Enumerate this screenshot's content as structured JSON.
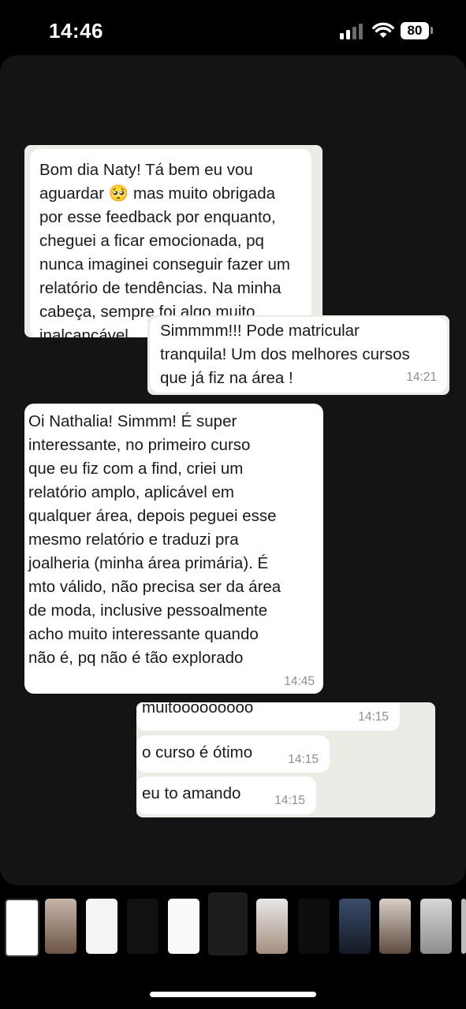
{
  "status_bar": {
    "time": "14:46",
    "battery": "80"
  },
  "screenshot_1": {
    "received": {
      "text": "Bom dia Naty! Tá bem eu vou\naguardar 🥺 mas muito obrigada\npor esse feedback por enquanto,\ncheguei a ficar emocionada, pq\nnunca imaginei conseguir fazer um\nrelatório de tendências. Na minha\ncabeça, sempre foi algo muito\ninalcançável"
    },
    "sent": {
      "text": "Simmmm!!! Pode matricular\ntranquila! Um dos melhores cursos\nque já fiz na área !",
      "time": "14:21"
    }
  },
  "main_message": {
    "text": "Oi Nathalia! Simmm! É super\ninteressante, no primeiro curso\nque eu fiz com a find, criei um\nrelatório amplo, aplicável em\nqualquer área, depois peguei esse\nmesmo relatório e traduzi pra\njoalheria (minha área primária). É\nmto válido, não precisa ser da área\nde moda, inclusive pessoalmente\nacho muito interessante quando\nnão é, pq não é tão explorado",
    "time": "14:45"
  },
  "screenshot_2": {
    "messages": [
      {
        "text": "muitooooooooo",
        "time": "14:15"
      },
      {
        "text": "o curso é ótimo",
        "time": "14:15"
      },
      {
        "text": "eu to amando",
        "time": "14:15"
      }
    ]
  },
  "thumbnail_strip": {
    "count": 12
  }
}
